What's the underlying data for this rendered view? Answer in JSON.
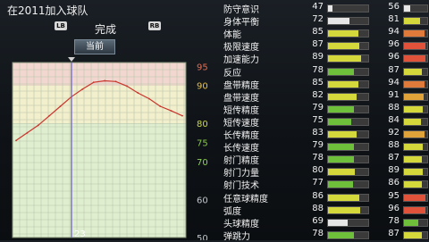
{
  "header": {
    "title": "在2011加入球队",
    "lb": "LB",
    "rb": "RB",
    "mode": "完成",
    "current_tab": "当前"
  },
  "chart_data": {
    "type": "line",
    "title": "",
    "xlabel": "",
    "ylabel": "",
    "ylim": [
      50,
      96
    ],
    "y_ticks": [
      {
        "value": 95,
        "color": "#e36d53"
      },
      {
        "value": 90,
        "color": "#e7c14b"
      },
      {
        "value": 80,
        "color": "#c9d64b"
      },
      {
        "value": 75,
        "color": "#88c64b"
      },
      {
        "value": 70,
        "color": "#8fcf5a"
      },
      {
        "value": 60,
        "color": "#bfc6cc"
      },
      {
        "value": 50,
        "color": "#bfc6cc"
      }
    ],
    "x_marker_label": "23",
    "x_marker_index": 5,
    "series": [
      {
        "color": "#c9342c",
        "values": [
          75.5,
          77.5,
          79.5,
          82,
          84.5,
          87,
          89,
          90.8,
          91.2,
          91,
          89.8,
          88,
          86.5,
          84.5,
          83.3,
          82
        ]
      }
    ],
    "grid": true
  },
  "stats": [
    {
      "label": "防守意识",
      "v1": 47,
      "v2": 56,
      "c1": "#e6e6e6",
      "c2": "#e6e6e6"
    },
    {
      "label": "身体平衡",
      "v1": 72,
      "v2": 81,
      "c1": "#e6e6e6",
      "c2": "#d4d83a"
    },
    {
      "label": "体能",
      "v1": 85,
      "v2": 94,
      "c1": "#d4d83a",
      "c2": "#e07a3a"
    },
    {
      "label": "极限速度",
      "v1": 87,
      "v2": 96,
      "c1": "#d4d83a",
      "c2": "#e0523a"
    },
    {
      "label": "加速能力",
      "v1": 89,
      "v2": 96,
      "c1": "#d4d83a",
      "c2": "#e0523a"
    },
    {
      "label": "反应",
      "v1": 78,
      "v2": 87,
      "c1": "#6ec03a",
      "c2": "#d4d83a"
    },
    {
      "label": "盘带精度",
      "v1": 85,
      "v2": 94,
      "c1": "#d4d83a",
      "c2": "#e07a3a"
    },
    {
      "label": "盘带速度",
      "v1": 82,
      "v2": 91,
      "c1": "#d4d83a",
      "c2": "#e0a33a"
    },
    {
      "label": "短传精度",
      "v1": 79,
      "v2": 88,
      "c1": "#6ec03a",
      "c2": "#d4d83a"
    },
    {
      "label": "短传速度",
      "v1": 75,
      "v2": 84,
      "c1": "#6ec03a",
      "c2": "#d4d83a"
    },
    {
      "label": "长传精度",
      "v1": 83,
      "v2": 92,
      "c1": "#d4d83a",
      "c2": "#e0a33a"
    },
    {
      "label": "长传速度",
      "v1": 79,
      "v2": 88,
      "c1": "#6ec03a",
      "c2": "#d4d83a"
    },
    {
      "label": "射门精度",
      "v1": 78,
      "v2": 87,
      "c1": "#6ec03a",
      "c2": "#d4d83a"
    },
    {
      "label": "射门力量",
      "v1": 80,
      "v2": 89,
      "c1": "#d4d83a",
      "c2": "#d4d83a"
    },
    {
      "label": "射门技术",
      "v1": 77,
      "v2": 86,
      "c1": "#6ec03a",
      "c2": "#d4d83a"
    },
    {
      "label": "任意球精度",
      "v1": 86,
      "v2": 95,
      "c1": "#d4d83a",
      "c2": "#e0523a"
    },
    {
      "label": "弧度",
      "v1": 88,
      "v2": 96,
      "c1": "#d4d83a",
      "c2": "#e0523a"
    },
    {
      "label": "头球精度",
      "v1": 69,
      "v2": 78,
      "c1": "#e6e6e6",
      "c2": "#6ec03a"
    },
    {
      "label": "弹跳力",
      "v1": 78,
      "v2": 87,
      "c1": "#6ec03a",
      "c2": "#d4d83a"
    }
  ]
}
